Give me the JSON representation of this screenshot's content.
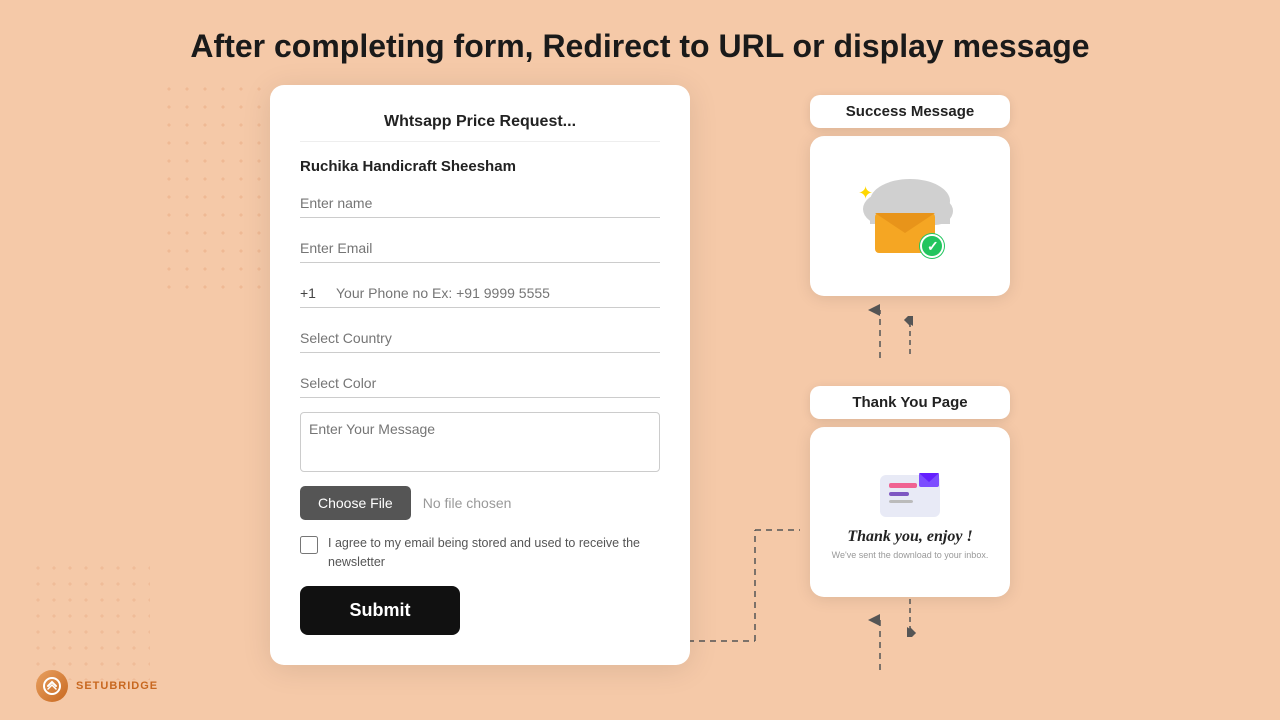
{
  "page": {
    "title": "After completing form, Redirect to URL or display message",
    "background_color": "#f5c9a8"
  },
  "form": {
    "header": "Whtsapp Price Request...",
    "subtitle": "Ruchika Handicraft Sheesham",
    "fields": {
      "name_placeholder": "Enter name",
      "email_placeholder": "Enter Email",
      "phone_code": "+1",
      "phone_placeholder": "Your Phone no Ex: +91 9999 5555",
      "country_placeholder": "Select Country",
      "color_placeholder": "Select Color",
      "message_placeholder": "Enter Your Message",
      "file_button": "Choose File",
      "file_status": "No file chosen"
    },
    "checkbox_label": "I agree to my email being stored and used to receive the newsletter",
    "submit_label": "Submit"
  },
  "success_message": {
    "badge": "Success Message",
    "alt": "Email sent success illustration"
  },
  "thank_you_page": {
    "badge": "Thank You Page",
    "title": "Thank you, enjoy !",
    "subtitle": "We've sent the download to your inbox."
  },
  "logo": {
    "text": "SETUBRIDGE"
  }
}
